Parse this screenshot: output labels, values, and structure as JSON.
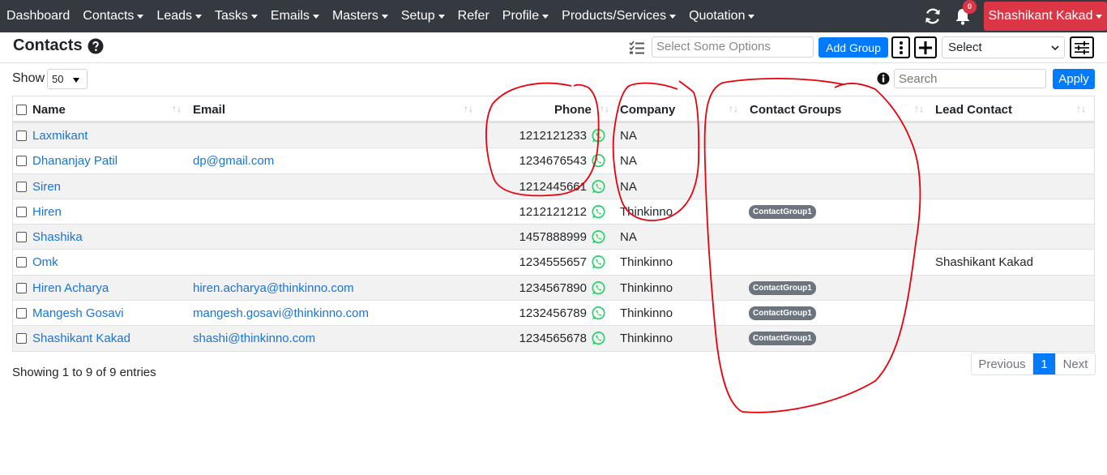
{
  "nav": {
    "items": [
      {
        "label": "Dashboard",
        "dropdown": false
      },
      {
        "label": "Contacts",
        "dropdown": true
      },
      {
        "label": "Leads",
        "dropdown": true
      },
      {
        "label": "Tasks",
        "dropdown": true
      },
      {
        "label": "Emails",
        "dropdown": true
      },
      {
        "label": "Masters",
        "dropdown": true
      },
      {
        "label": "Setup",
        "dropdown": true
      },
      {
        "label": "Refer",
        "dropdown": false
      },
      {
        "label": "Profile",
        "dropdown": true
      },
      {
        "label": "Products/Services",
        "dropdown": true
      },
      {
        "label": "Quotation",
        "dropdown": true
      }
    ],
    "notification_count": "0",
    "user_name": "Shashikant Kakad"
  },
  "header": {
    "title": "Contacts",
    "group_placeholder": "Select Some Options",
    "add_group_label": "Add Group",
    "select_value": "Select"
  },
  "controls": {
    "show_label": "Show",
    "page_size": "50",
    "search_placeholder": "Search",
    "apply_label": "Apply"
  },
  "table": {
    "columns": {
      "name": "Name",
      "email": "Email",
      "phone": "Phone",
      "company": "Company",
      "groups": "Contact Groups",
      "lead_contact": "Lead Contact"
    },
    "rows": [
      {
        "name": "Laxmikant",
        "email": "",
        "phone": "1212121233",
        "company": "NA",
        "group": "",
        "lead_contact": ""
      },
      {
        "name": "Dhananjay Patil",
        "email": "dp@gmail.com",
        "phone": "1234676543",
        "company": "NA",
        "group": "",
        "lead_contact": ""
      },
      {
        "name": "Siren",
        "email": "",
        "phone": "1212445661",
        "company": "NA",
        "group": "",
        "lead_contact": ""
      },
      {
        "name": "Hiren",
        "email": "",
        "phone": "1212121212",
        "company": "Thinkinno",
        "group": "ContactGroup1",
        "lead_contact": ""
      },
      {
        "name": "Shashika",
        "email": "",
        "phone": "1457888999",
        "company": "NA",
        "group": "",
        "lead_contact": ""
      },
      {
        "name": "Omk",
        "email": "",
        "phone": "1234555657",
        "company": "Thinkinno",
        "group": "",
        "lead_contact": "Shashikant Kakad"
      },
      {
        "name": "Hiren Acharya",
        "email": "hiren.acharya@thinkinno.com",
        "phone": "1234567890",
        "company": "Thinkinno",
        "group": "ContactGroup1",
        "lead_contact": ""
      },
      {
        "name": "Mangesh Gosavi",
        "email": "mangesh.gosavi@thinkinno.com",
        "phone": "1232456789",
        "company": "Thinkinno",
        "group": "ContactGroup1",
        "lead_contact": ""
      },
      {
        "name": "Shashikant Kakad",
        "email": "shashi@thinkinno.com",
        "phone": "1234565678",
        "company": "Thinkinno",
        "group": "ContactGroup1",
        "lead_contact": ""
      }
    ]
  },
  "footer": {
    "showing": "Showing 1 to 9 of 9 entries",
    "prev_label": "Previous",
    "current_page": "1",
    "next_label": "Next"
  },
  "colors": {
    "navbar": "#343a40",
    "primary": "#007bff",
    "danger": "#dc3545",
    "link": "#1a73d8",
    "whatsapp": "#25d366",
    "badge": "#6c757d",
    "annotation": "#e8000b"
  },
  "icons": [
    "refresh-icon",
    "bell-icon",
    "help-icon",
    "list-icon",
    "kebab-icon",
    "plus-icon",
    "settings-sliders-icon",
    "info-icon",
    "whatsapp-icon"
  ]
}
